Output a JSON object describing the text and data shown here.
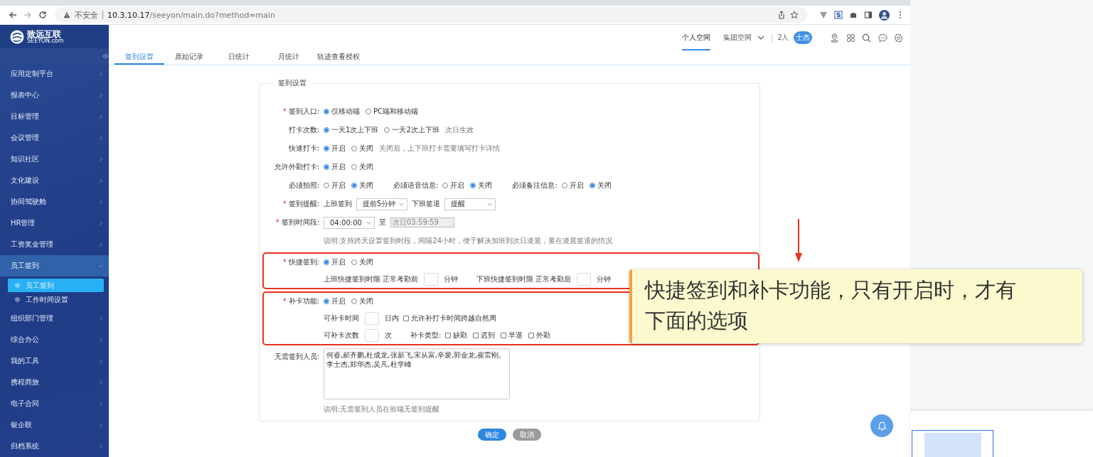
{
  "browser": {
    "warning": "不安全",
    "url_host": "10.3.10.17",
    "url_path": "/seeyon/main.do?method=main"
  },
  "sidebar": {
    "logo_cn": "致远互联",
    "logo_en": "SEEYON.com",
    "items": [
      {
        "label": "应用定制平台",
        "expanded": false
      },
      {
        "label": "报表中心",
        "expanded": false
      },
      {
        "label": "目标管理",
        "expanded": false
      },
      {
        "label": "会议管理",
        "expanded": false
      },
      {
        "label": "知识社区",
        "expanded": false
      },
      {
        "label": "文化建设",
        "expanded": false
      },
      {
        "label": "协同驾驶舱",
        "expanded": false
      },
      {
        "label": "HR管理",
        "expanded": false
      },
      {
        "label": "工资奖金管理",
        "expanded": false
      },
      {
        "label": "员工签到",
        "expanded": true,
        "children": [
          {
            "label": "员工签到",
            "selected": true
          },
          {
            "label": "工作时间设置",
            "selected": false
          }
        ]
      },
      {
        "label": "组织部门管理",
        "expanded": false
      },
      {
        "label": "综合办公",
        "expanded": false
      },
      {
        "label": "我的工具",
        "expanded": false
      },
      {
        "label": "携程商旅",
        "expanded": false
      },
      {
        "label": "电子合同",
        "expanded": false
      },
      {
        "label": "银企联",
        "expanded": false
      },
      {
        "label": "归档系统",
        "expanded": false
      }
    ]
  },
  "header": {
    "spaces": [
      {
        "label": "个人空间",
        "selected": true,
        "dropdown": false
      },
      {
        "label": "集团空间",
        "selected": false,
        "dropdown": true
      }
    ],
    "online": "2人",
    "user_badge": "士杰"
  },
  "tabs": [
    {
      "label": "签到设置",
      "selected": true
    },
    {
      "label": "原始记录",
      "selected": false
    },
    {
      "label": "日统计",
      "selected": false
    },
    {
      "label": "月统计",
      "selected": false
    },
    {
      "label": "轨迹查看授权",
      "selected": false
    }
  ],
  "form": {
    "title": "签到设置",
    "groups": [
      {
        "highlighted": false,
        "rows": [
          {
            "label": "签到入口:",
            "marker": "*",
            "parts": [
              {
                "kind": "radio",
                "label": "仅移动端",
                "selected": true
              },
              {
                "kind": "radio",
                "label": "PC端和移动端",
                "selected": false
              }
            ]
          },
          {
            "label": "打卡次数:",
            "parts": [
              {
                "kind": "radio",
                "label": "一天1次上下班",
                "selected": true
              },
              {
                "kind": "radio",
                "label": "一天2次上下班",
                "selected": false
              },
              {
                "kind": "note",
                "text": "次日生效"
              }
            ]
          },
          {
            "label": "快速打卡:",
            "parts": [
              {
                "kind": "radio",
                "label": "开启",
                "selected": true
              },
              {
                "kind": "radio",
                "label": "关闭",
                "selected": false
              },
              {
                "kind": "note",
                "text": "关闭后，上下班打卡需要填写打卡详情"
              }
            ]
          },
          {
            "label": "允许外勤打卡:",
            "parts": [
              {
                "kind": "radio",
                "label": "开启",
                "selected": true
              },
              {
                "kind": "radio",
                "label": "关闭",
                "selected": false
              }
            ]
          },
          {
            "label": "必须拍照:",
            "parts": [
              {
                "kind": "radio",
                "label": "开启",
                "selected": false
              },
              {
                "kind": "radio",
                "label": "关闭",
                "selected": true
              },
              {
                "kind": "label",
                "text": "必须语音信息:"
              },
              {
                "kind": "radio",
                "label": "开启",
                "selected": false
              },
              {
                "kind": "radio",
                "label": "关闭",
                "selected": true
              },
              {
                "kind": "label",
                "text": "必须备注信息:"
              },
              {
                "kind": "radio",
                "label": "开启",
                "selected": false
              },
              {
                "kind": "radio",
                "label": "关闭",
                "selected": true
              }
            ]
          },
          {
            "label": "签到提醒:",
            "marker": "*",
            "parts": [
              {
                "kind": "text",
                "text": "上班签到"
              },
              {
                "kind": "select",
                "value": "提前5分钟"
              },
              {
                "kind": "text",
                "text": "下班签退"
              },
              {
                "kind": "select",
                "value": "提醒"
              }
            ]
          },
          {
            "label": "签到时间段:",
            "marker": "*",
            "parts": [
              {
                "kind": "select",
                "value": "04:00:00"
              },
              {
                "kind": "text",
                "text": "至"
              },
              {
                "kind": "readonly",
                "value": "次日03:59:59"
              }
            ]
          },
          {
            "parts": [
              {
                "kind": "note",
                "text": "说明:支持跨天设置签到时段，间隔24小时，便于解决加班到次日凌晨，要在凌晨签退的情况"
              }
            ]
          }
        ]
      },
      {
        "highlighted": true,
        "rows": [
          {
            "label": "快捷签到:",
            "marker": "*",
            "parts": [
              {
                "kind": "radio",
                "label": "开启",
                "selected": true
              },
              {
                "kind": "radio",
                "label": "关闭",
                "selected": false
              }
            ]
          },
          {
            "parts": [
              {
                "kind": "text",
                "text": "上班快捷签到时限 正常考勤前"
              },
              {
                "kind": "box"
              },
              {
                "kind": "text",
                "text": "分钟"
              },
              {
                "kind": "label",
                "text": "下班快捷签到时限 正常考勤后"
              },
              {
                "kind": "box"
              },
              {
                "kind": "text",
                "text": "分钟"
              }
            ]
          }
        ]
      },
      {
        "highlighted": true,
        "rows": [
          {
            "label": "补卡功能:",
            "marker": "*",
            "parts": [
              {
                "kind": "radio",
                "label": "开启",
                "selected": true
              },
              {
                "kind": "radio",
                "label": "关闭",
                "selected": false
              }
            ]
          },
          {
            "parts": [
              {
                "kind": "text",
                "text": "可补卡时间"
              },
              {
                "kind": "box"
              },
              {
                "kind": "text",
                "text": "日内"
              },
              {
                "kind": "checkbox",
                "label": "允许补打卡时间跨越自然周",
                "checked": false
              }
            ]
          },
          {
            "parts": [
              {
                "kind": "text",
                "text": "可补卡次数"
              },
              {
                "kind": "box"
              },
              {
                "kind": "text",
                "text": "次"
              },
              {
                "kind": "label",
                "text": "补卡类型:"
              },
              {
                "kind": "checkbox",
                "label": "缺勤",
                "checked": false
              },
              {
                "kind": "checkbox",
                "label": "迟到",
                "checked": false
              },
              {
                "kind": "checkbox",
                "label": "早退",
                "checked": false
              },
              {
                "kind": "checkbox",
                "label": "外勤",
                "checked": false
              }
            ]
          }
        ]
      },
      {
        "highlighted": false,
        "rows": [
          {
            "label": "无需签到人员:",
            "parts": [
              {
                "kind": "textarea",
                "value": "何睿,郝齐鹏,杜成龙,张新飞,宋从富,辛裴,郭金龙,崔雷刚,李士杰,郑华杰,吴凡,杜学峰"
              }
            ]
          },
          {
            "parts": [
              {
                "kind": "note",
                "text": "说明:无需签到人员在前端无签到提醒"
              }
            ]
          }
        ]
      }
    ],
    "buttons": [
      {
        "label": "确定",
        "kind": "primary"
      },
      {
        "label": "取消",
        "kind": "secondary"
      }
    ]
  },
  "callout": {
    "text": "快捷签到和补卡功能，只有开启时，才有下面的选项"
  }
}
